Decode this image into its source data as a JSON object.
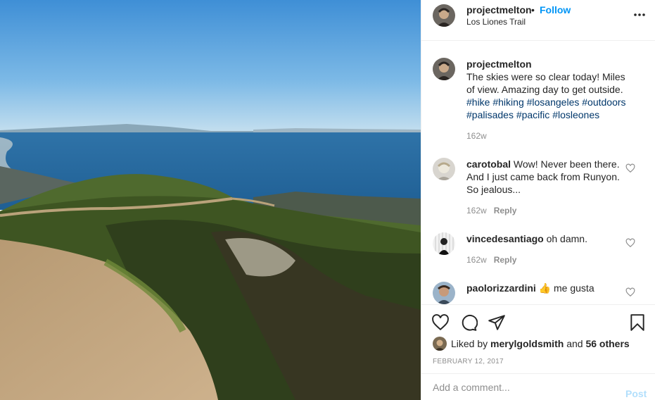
{
  "post": {
    "username": "projectmelton",
    "separator": "•",
    "follow_label": "Follow",
    "location": "Los Liones Trail",
    "more_icon": "ellipsis-icon"
  },
  "caption": {
    "username": "projectmelton",
    "text": "The skies were so clear today! Miles of view. Amazing day to get outside.",
    "hashtags": [
      "#hike",
      "#hiking",
      "#losangeles",
      "#outdoors",
      "#palisades",
      "#pacific",
      "#losleones"
    ],
    "time": "162w"
  },
  "comments": [
    {
      "username": "carotobal",
      "text": "Wow! Never been there. And I just came back from Runyon. So jealous...",
      "time": "162w",
      "reply_label": "Reply"
    },
    {
      "username": "vincedesantiago",
      "text": "oh damn.",
      "time": "162w",
      "reply_label": "Reply"
    },
    {
      "username": "paolorizzardini",
      "emoji": "👍",
      "text": "me gusta"
    }
  ],
  "likes": {
    "prefix": "Liked by",
    "user": "merylgoldsmith",
    "conjunction": "and",
    "others": "56 others"
  },
  "date": "FEBRUARY 12, 2017",
  "add_comment": {
    "placeholder": "Add a comment...",
    "post_label": "Post"
  },
  "colors": {
    "link": "#0095f6",
    "hashtag": "#00376b",
    "muted": "#8e8e8e",
    "post_disabled": "#b2dffc"
  },
  "icons": [
    "heart-icon",
    "comment-icon",
    "share-icon",
    "bookmark-icon"
  ]
}
